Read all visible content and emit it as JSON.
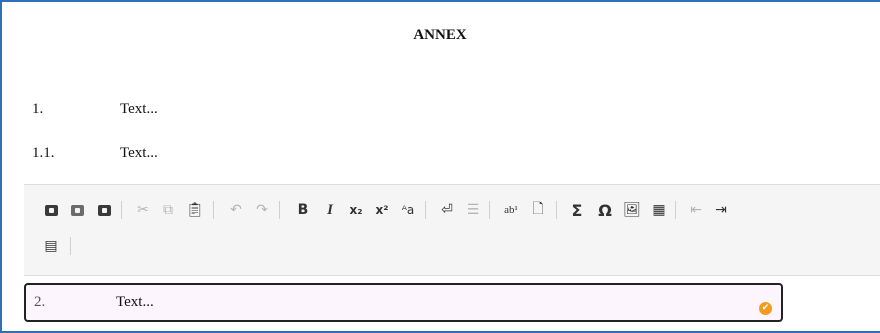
{
  "document": {
    "title": "ANNEX",
    "items": [
      {
        "number": "1.",
        "text": "Text..."
      },
      {
        "number": "1.1.",
        "text": "Text..."
      }
    ],
    "active_item": {
      "number": "2.",
      "text": "Text..."
    }
  },
  "toolbar": {
    "bold": "B",
    "italic": "I",
    "subscript": "x₂",
    "superscript": "x²",
    "case": "ᴬa",
    "footnote": "ab¹",
    "sigma": "Σ",
    "omega": "Ω"
  },
  "colors": {
    "frame": "#2f6fb5",
    "accent": "#f39a21",
    "edit_bg": "#fdf5fd"
  }
}
